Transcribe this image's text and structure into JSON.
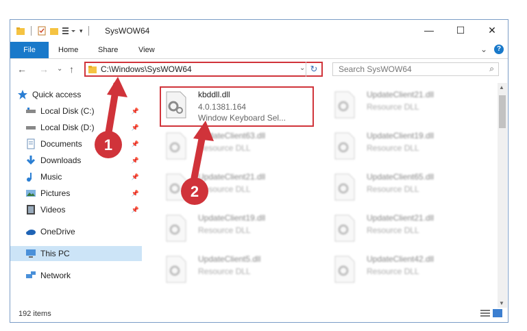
{
  "window": {
    "title": "SysWOW64"
  },
  "win_buttons": {
    "minimize": "—",
    "maximize": "☐",
    "close": "✕"
  },
  "ribbon": {
    "tabs": [
      "File",
      "Home",
      "Share",
      "View"
    ],
    "expand_icon": "⌄",
    "help_icon": "?"
  },
  "address": {
    "path": "C:\\Windows\\SysWOW64",
    "dropdown": "⌄",
    "refresh": "↻"
  },
  "search": {
    "placeholder": "Search SysWOW64",
    "icon": "⌕"
  },
  "nav": {
    "back": "←",
    "forward": "→",
    "recent": "⌄",
    "up": "↑",
    "items": [
      {
        "label": "Quick access",
        "icon": "star-icon"
      },
      {
        "label": "Local Disk (C:)",
        "icon": "drive-icon"
      },
      {
        "label": "Local Disk (D:)",
        "icon": "drive-icon"
      },
      {
        "label": "Documents",
        "icon": "documents-icon"
      },
      {
        "label": "Downloads",
        "icon": "downloads-icon"
      },
      {
        "label": "Music",
        "icon": "music-icon"
      },
      {
        "label": "Pictures",
        "icon": "pictures-icon"
      },
      {
        "label": "Videos",
        "icon": "videos-icon"
      },
      {
        "label": "OneDrive",
        "icon": "onedrive-icon"
      },
      {
        "label": "This PC",
        "icon": "this-pc-icon"
      },
      {
        "label": "Network",
        "icon": "network-icon"
      }
    ]
  },
  "files": [
    {
      "name": "kbddll.dll",
      "version": "4.0.1381.164",
      "desc": "Window Keyboard Sel..."
    },
    {
      "name": "UpdateClient21.dll",
      "desc": "Resource DLL"
    },
    {
      "name": "UpdateClient63.dll",
      "desc": "Resource DLL"
    },
    {
      "name": "UpdateClient19.dll",
      "desc": "Resource DLL"
    },
    {
      "name": "UpdateClient21.dll",
      "desc": "Resource DLL"
    },
    {
      "name": "UpdateClient65.dll",
      "desc": "Resource DLL"
    },
    {
      "name": "UpdateClient19.dll",
      "desc": "Resource DLL"
    },
    {
      "name": "UpdateClient21.dll",
      "desc": "Resource DLL"
    },
    {
      "name": "UpdateClient5.dll",
      "desc": "Resource DLL"
    },
    {
      "name": "UpdateClient42.dll",
      "desc": "Resource DLL"
    }
  ],
  "status": {
    "count": "192 items"
  },
  "annotations": {
    "step1": "1",
    "step2": "2",
    "color": "#d0333a"
  }
}
